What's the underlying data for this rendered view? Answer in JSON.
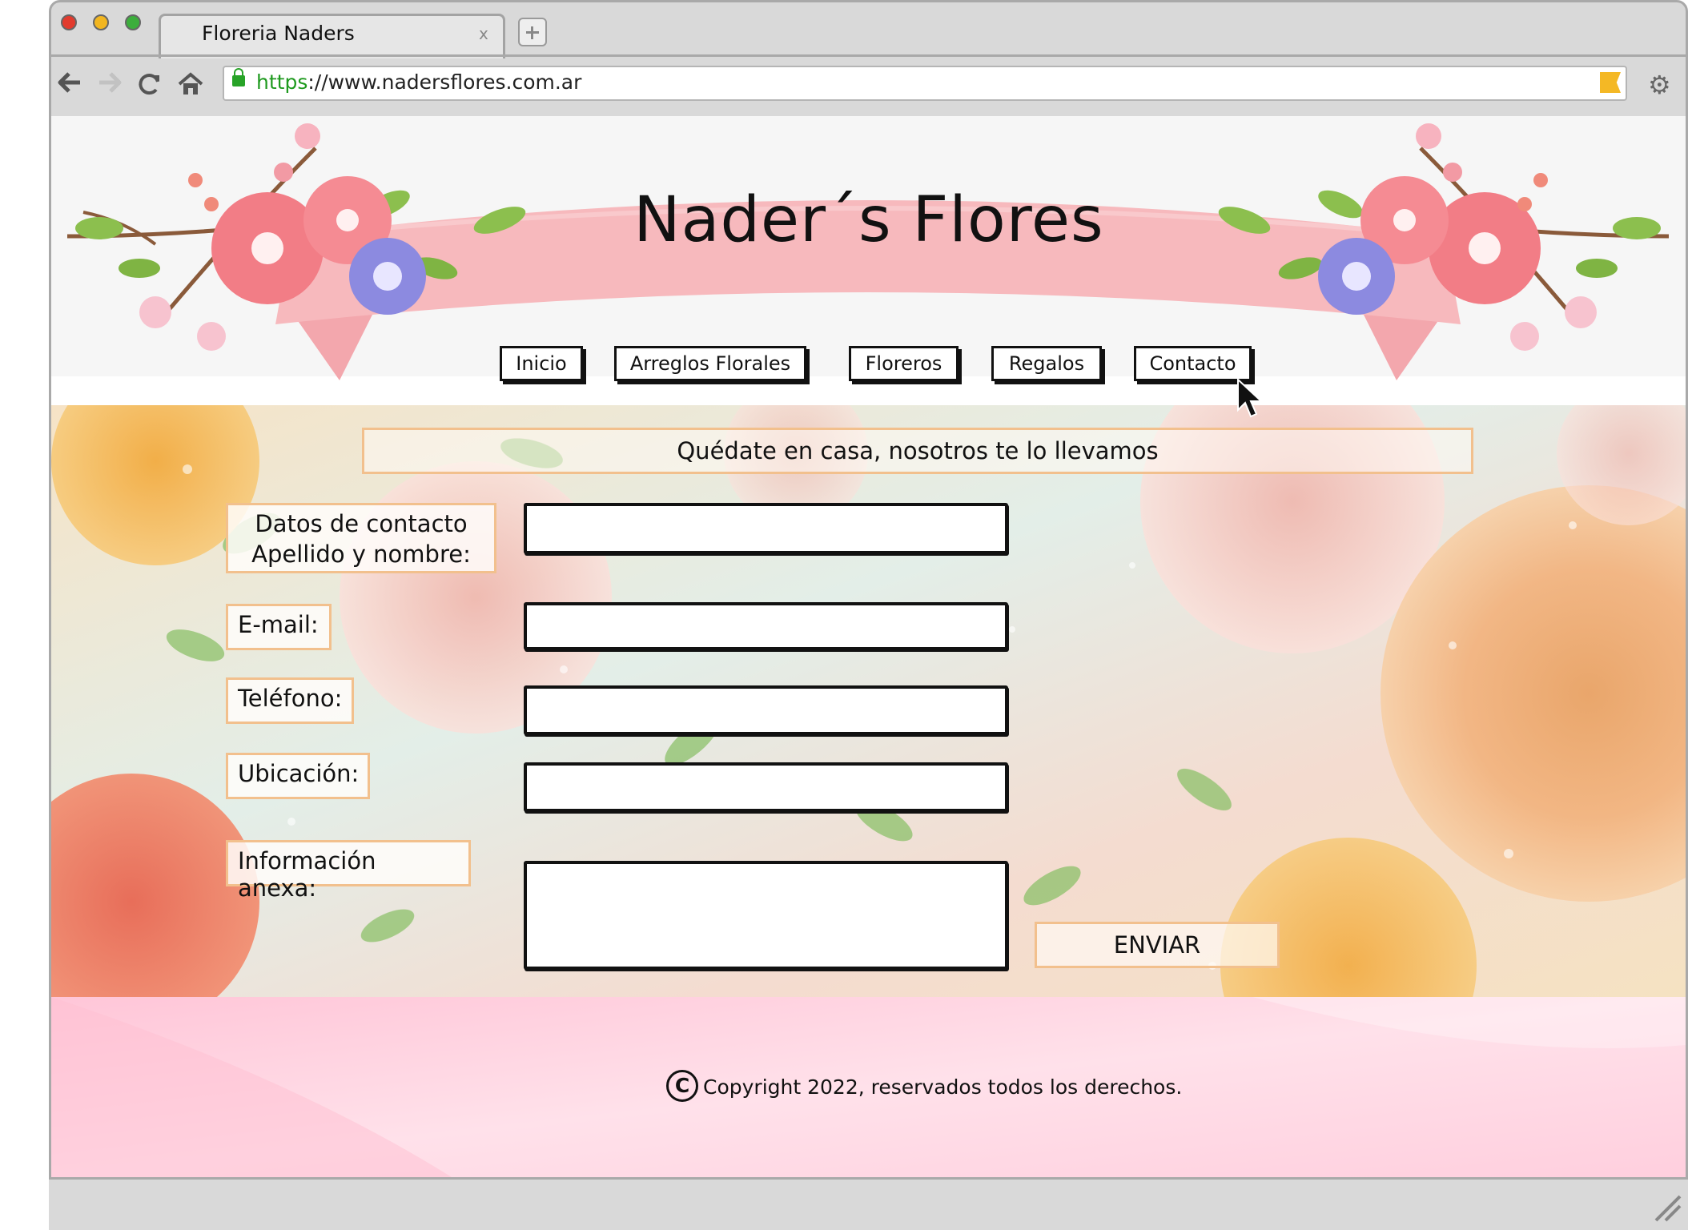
{
  "browser": {
    "tab_title": "Floreria Naders",
    "tab_close": "x",
    "url_scheme": "https",
    "url_rest": "://www.nadersflores.com.ar",
    "icons": [
      "back-icon",
      "forward-icon",
      "reload-icon",
      "home-icon",
      "lock-icon",
      "bookmark-icon",
      "gear-icon",
      "new-tab-icon"
    ]
  },
  "site": {
    "title": "Nader´s Flores",
    "nav": [
      {
        "label": "Inicio"
      },
      {
        "label": "Arreglos Florales"
      },
      {
        "label": "Floreros"
      },
      {
        "label": "Regalos"
      },
      {
        "label": "Contacto"
      }
    ],
    "tagline": "Quédate en casa, nosotros te lo llevamos"
  },
  "form": {
    "fields": [
      {
        "label_line1": "Datos de contacto",
        "label_line2": "Apellido y nombre:",
        "value": ""
      },
      {
        "label": "E-mail:",
        "value": ""
      },
      {
        "label": "Teléfono:",
        "value": ""
      },
      {
        "label": "Ubicación:",
        "value": ""
      },
      {
        "label": "Información anexa:",
        "value": ""
      }
    ],
    "submit_label": "ENVIAR"
  },
  "footer": {
    "copyright_symbol": "C",
    "copyright_text": "Copyright 2022, reservados todos los derechos."
  },
  "colors": {
    "banner_pink": "#f7b9bd",
    "accent_peach": "#f2c08d",
    "footer_pink": "#ffd6e3",
    "lock_green": "#27a327"
  }
}
